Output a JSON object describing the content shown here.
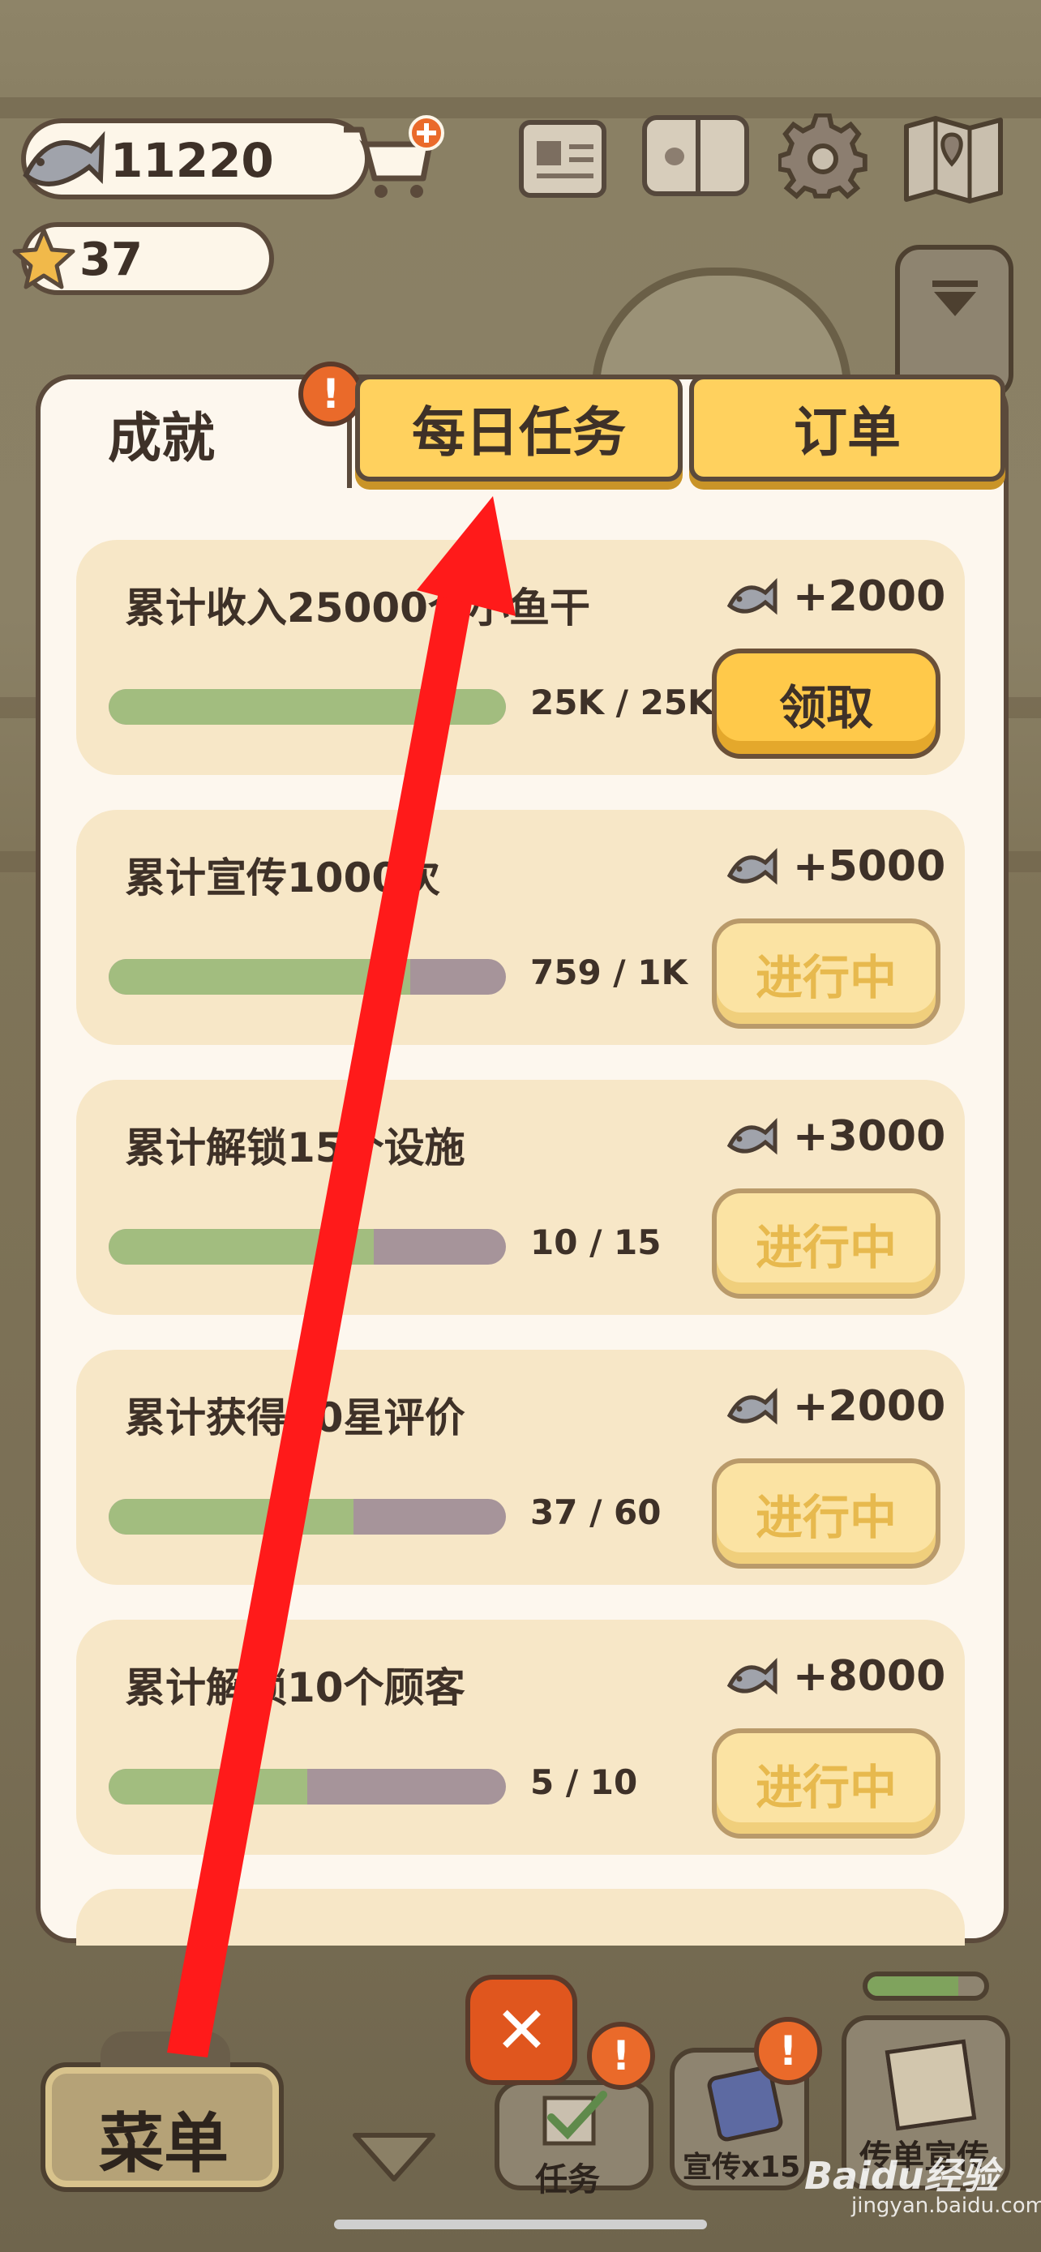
{
  "hud": {
    "fish_count": "11220",
    "star_count": "37"
  },
  "tabs": {
    "achievements": "成就",
    "daily_tasks": "每日任务",
    "orders": "订单",
    "alert_glyph": "!"
  },
  "achievements": [
    {
      "title": "累计收入25000个小鱼干",
      "reward": "+2000",
      "progress_text": "25K / 25K",
      "progress": 1.0,
      "button": "领取",
      "state": "claimable"
    },
    {
      "title": "累计宣传1000次",
      "reward": "+5000",
      "progress_text": "759 /  1K",
      "progress": 0.759,
      "button": "进行中",
      "state": "in-progress"
    },
    {
      "title": "累计解锁15个设施",
      "reward": "+3000",
      "progress_text": "10  /  15",
      "progress": 0.667,
      "button": "进行中",
      "state": "in-progress"
    },
    {
      "title": "累计获得60星评价",
      "reward": "+2000",
      "progress_text": "37  /  60",
      "progress": 0.617,
      "button": "进行中",
      "state": "in-progress"
    },
    {
      "title": "累计解锁10个顾客",
      "reward": "+8000",
      "progress_text": "5  /  10",
      "progress": 0.5,
      "button": "进行中",
      "state": "in-progress"
    }
  ],
  "bottom": {
    "menu_label": "菜单",
    "tasks_label": "任务",
    "promote_label": "宣传x15",
    "flyer_label": "传单宣传",
    "close_glyph": "✕",
    "alert_glyph": "!"
  },
  "watermark": {
    "brand": "Baidu经验",
    "url": "jingyan.baidu.com"
  },
  "colors": {
    "accent_yellow": "#ffd15e",
    "progress_green": "#a2bd7f",
    "annotation_red": "#ff1a1a",
    "alert_orange": "#ea6a2a"
  },
  "icons": [
    "fish-icon",
    "cart-plus-icon",
    "star-icon",
    "newspaper-icon",
    "paw-book-icon",
    "gear-icon",
    "map-icon",
    "chevron-down-icon",
    "close-icon",
    "check-icon",
    "alert-icon"
  ]
}
